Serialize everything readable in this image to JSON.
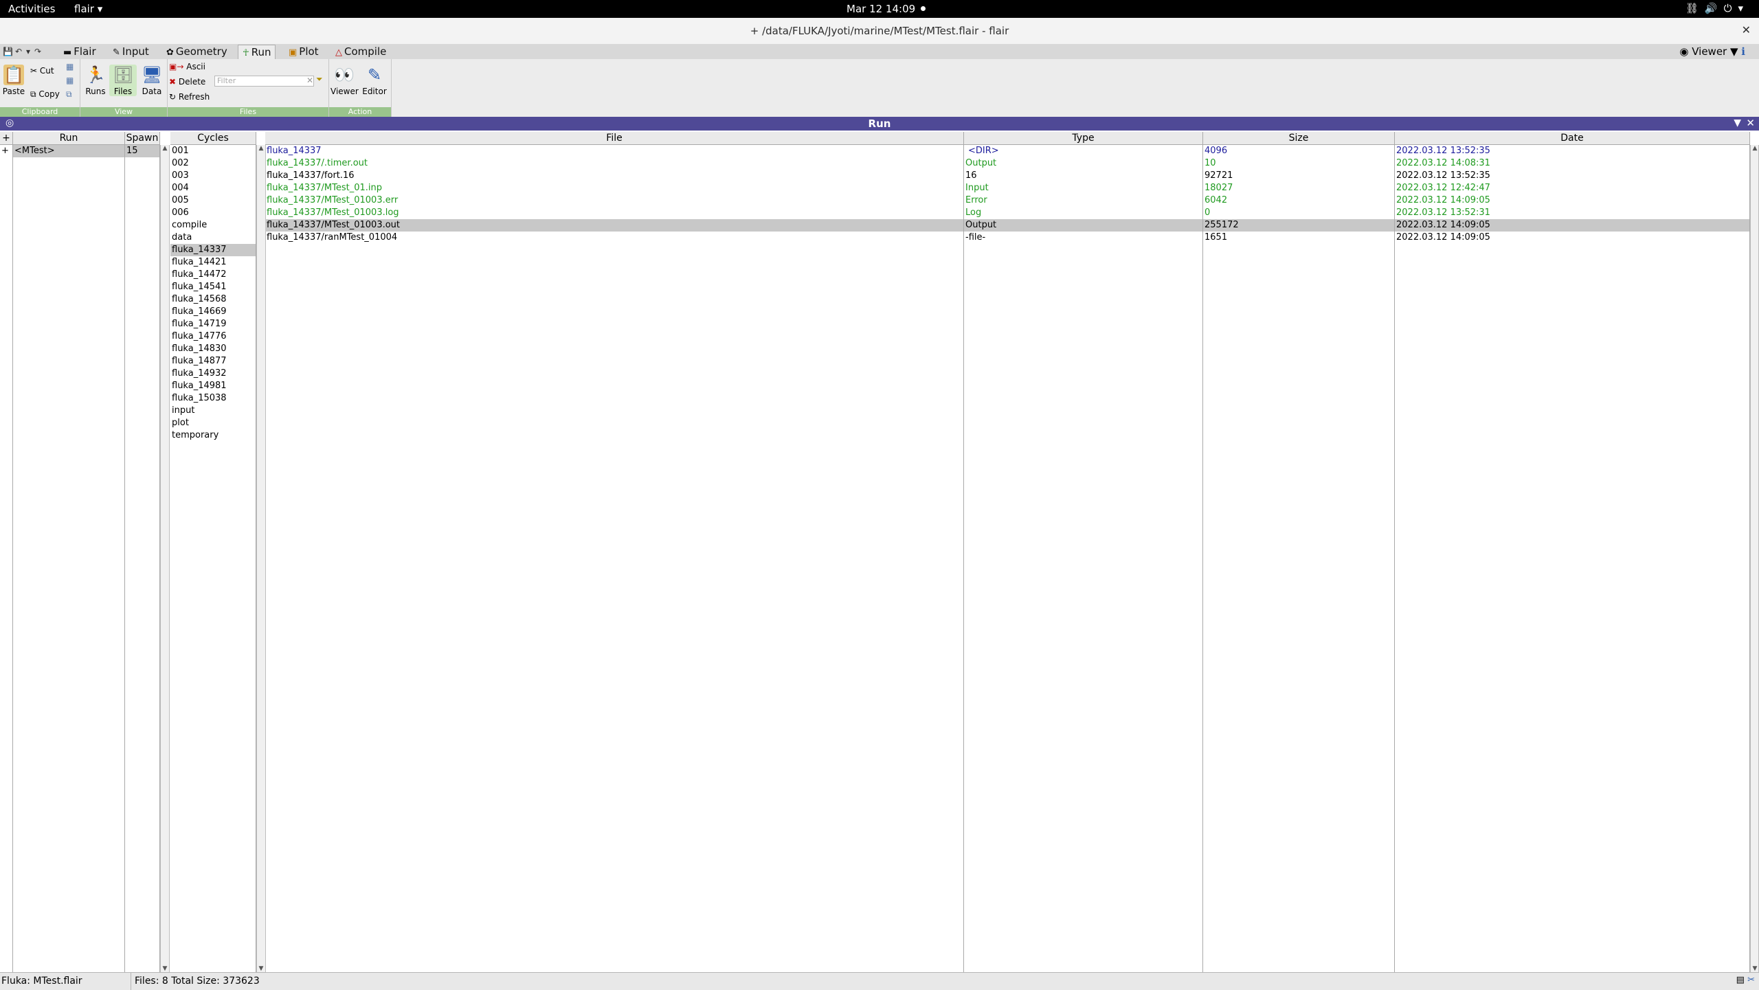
{
  "topbar": {
    "activities": "Activities",
    "app_menu": "flair ▾",
    "clock": "Mar 12  14:09",
    "tray_icons": [
      "network-icon",
      "volume-icon",
      "power-icon"
    ]
  },
  "window": {
    "title": "+ /data/FLUKA/Jyoti/marine/MTest/MTest.flair - flair"
  },
  "ribbon": {
    "tabs": [
      {
        "label": "Flair",
        "icon": "flair-icon"
      },
      {
        "label": "Input",
        "icon": "input-icon"
      },
      {
        "label": "Geometry",
        "icon": "geometry-icon"
      },
      {
        "label": "Run",
        "icon": "run-icon"
      },
      {
        "label": "Plot",
        "icon": "plot-icon"
      },
      {
        "label": "Compile",
        "icon": "compile-icon"
      }
    ],
    "active_tab": "Run",
    "viewer_label": "Viewer ▼",
    "clipboard": {
      "group": "Clipboard",
      "paste": "Paste",
      "cut": "Cut",
      "copy": "Copy"
    },
    "view": {
      "group": "View",
      "runs": "Runs",
      "files": "Files",
      "data": "Data"
    },
    "files": {
      "group": "Files",
      "ascii": "Ascii",
      "delete": "Delete",
      "refresh": "Refresh",
      "filter_placeholder": "Filter"
    },
    "action": {
      "group": "Action",
      "viewer": "Viewer",
      "editor": "Editor"
    }
  },
  "run_panel": {
    "title": "Run",
    "columns": {
      "run": "Run",
      "spawn": "Spawn",
      "cycles": "Cycles",
      "file": "File",
      "type": "Type",
      "size": "Size",
      "date": "Date"
    },
    "runs": [
      {
        "name": "<MTest>",
        "spawn": "15"
      }
    ],
    "cycles": [
      "001",
      "002",
      "003",
      "004",
      "005",
      "006",
      "compile",
      "data",
      "fluka_14337",
      "fluka_14421",
      "fluka_14472",
      "fluka_14541",
      "fluka_14568",
      "fluka_14669",
      "fluka_14719",
      "fluka_14776",
      "fluka_14830",
      "fluka_14877",
      "fluka_14932",
      "fluka_14981",
      "fluka_15038",
      "input",
      "plot",
      "temporary"
    ],
    "selected_cycle": "fluka_14337",
    "files": [
      {
        "file": "fluka_14337",
        "type": "<DIR>",
        "size": "4096",
        "date": "2022.03.12 13:52:35",
        "color": "#1c1c9c"
      },
      {
        "file": "fluka_14337/.timer.out",
        "type": "Output",
        "size": "10",
        "date": "2022.03.12 14:08:31",
        "color": "#1f9a1f"
      },
      {
        "file": "fluka_14337/fort.16",
        "type": "16",
        "size": "92721",
        "date": "2022.03.12 13:52:35",
        "color": "#000000"
      },
      {
        "file": "fluka_14337/MTest_01.inp",
        "type": "Input",
        "size": "18027",
        "date": "2022.03.12 12:42:47",
        "color": "#1f9a1f"
      },
      {
        "file": "fluka_14337/MTest_01003.err",
        "type": "Error",
        "size": "6042",
        "date": "2022.03.12 14:09:05",
        "color": "#1f9a1f"
      },
      {
        "file": "fluka_14337/MTest_01003.log",
        "type": "Log",
        "size": "0",
        "date": "2022.03.12 13:52:31",
        "color": "#1f9a1f"
      },
      {
        "file": "fluka_14337/MTest_01003.out",
        "type": "Output",
        "size": "255172",
        "date": "2022.03.12 14:09:05",
        "color": "#000000",
        "selected": true
      },
      {
        "file": "fluka_14337/ranMTest_01004",
        "type": "-file-",
        "size": "1651",
        "date": "2022.03.12 14:09:05",
        "color": "#000000"
      }
    ]
  },
  "status": {
    "left": "Fluka: MTest.flair",
    "right": "Files: 8 Total Size: 373623"
  },
  "colors": {
    "run_header": "#4f4996",
    "group_label": "#9ac48c",
    "green_text": "#1f9a1f",
    "blue_text": "#1c1c9c"
  }
}
